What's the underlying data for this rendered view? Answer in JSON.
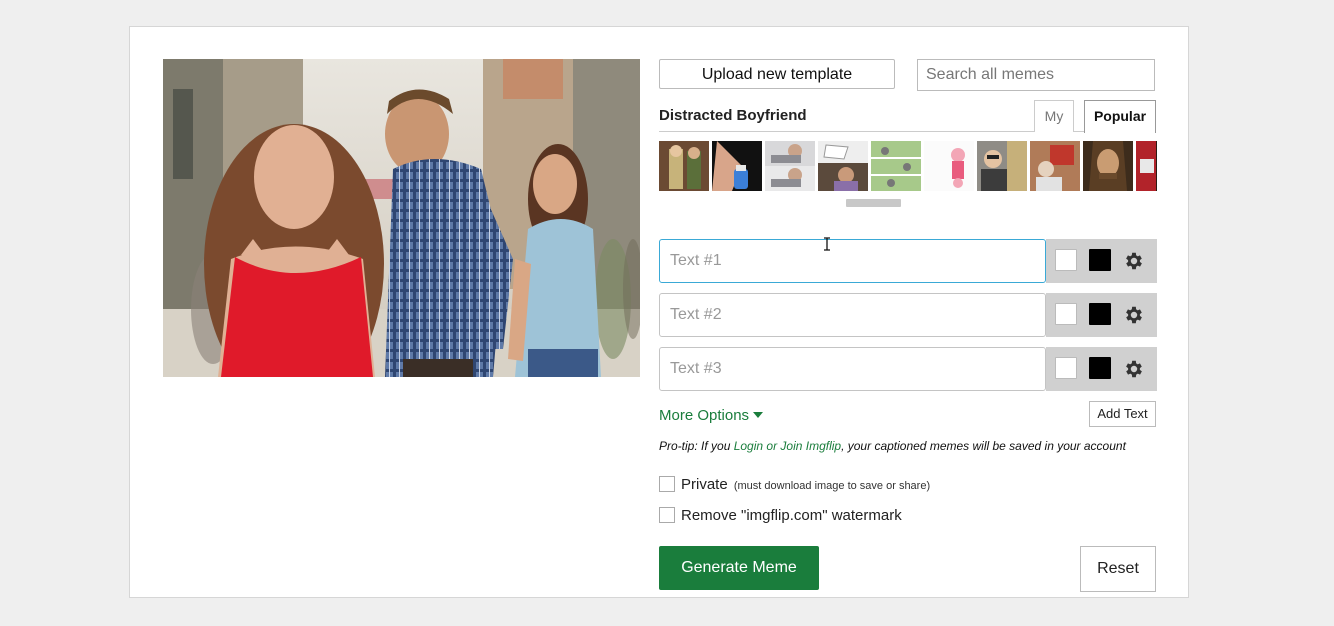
{
  "editor": {
    "upload_label": "Upload new template",
    "search_placeholder": "Search all memes",
    "template_name": "Distracted Boyfriend",
    "tabs": [
      {
        "label": "My",
        "active": false
      },
      {
        "label": "Popular",
        "active": true
      }
    ],
    "text_boxes": [
      {
        "placeholder": "Text #1",
        "value": "",
        "focused": true,
        "text_color": "#ffffff",
        "outline_color": "#000000"
      },
      {
        "placeholder": "Text #2",
        "value": "",
        "focused": false,
        "text_color": "#ffffff",
        "outline_color": "#000000"
      },
      {
        "placeholder": "Text #3",
        "value": "",
        "focused": false,
        "text_color": "#ffffff",
        "outline_color": "#000000"
      }
    ],
    "more_options_label": "More Options",
    "add_text_label": "Add Text",
    "protip": {
      "prefix": "Pro-tip: If you ",
      "link": "Login or Join Imgflip",
      "suffix": ", your captioned memes will be saved in your account"
    },
    "private_label": "Private",
    "private_note": "(must download image to save or share)",
    "watermark_label": "Remove \"imgflip.com\" watermark",
    "generate_label": "Generate Meme",
    "reset_label": "Reset"
  },
  "colors": {
    "accent_green": "#1a7d3c",
    "focus_blue": "#3aa9d6",
    "panel_bg": "#ffffff",
    "page_bg": "#efefef"
  }
}
